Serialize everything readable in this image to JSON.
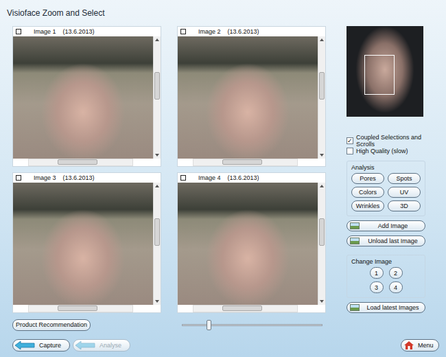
{
  "window": {
    "title": "Visioface Zoom and Select"
  },
  "images": [
    {
      "label": "Image 1",
      "date": "(13.6.2013)",
      "vscroll": 0.35,
      "hscroll": 0.45
    },
    {
      "label": "Image 2",
      "date": "(13.6.2013)",
      "vscroll": 0.35,
      "hscroll": 0.45
    },
    {
      "label": "Image 3",
      "date": "(13.6.2013)",
      "vscroll": 0.35,
      "hscroll": 0.45
    },
    {
      "label": "Image 4",
      "date": "(13.6.2013)",
      "vscroll": 0.35,
      "hscroll": 0.45
    }
  ],
  "options": [
    {
      "label": "Coupled Selections and Scrolls",
      "checked": true
    },
    {
      "label": "High Quality (slow)",
      "checked": false
    }
  ],
  "analysis": {
    "title": "Analysis",
    "buttons": [
      "Pores",
      "Spots",
      "Colors",
      "UV",
      "Wrinkles",
      "3D"
    ]
  },
  "image_actions": [
    "Add Image",
    "Unload last Image"
  ],
  "change_image": {
    "title": "Change Image",
    "buttons": [
      "1",
      "2",
      "3",
      "4"
    ]
  },
  "load_button": "Load latest Images",
  "product_button": "Product Recommendation",
  "slider": {
    "level": 0.18
  },
  "footer": {
    "buttons": [
      {
        "label": "Capture",
        "disabled": false
      },
      {
        "label": "Analyse",
        "disabled": true
      }
    ],
    "menu": "Menu"
  }
}
